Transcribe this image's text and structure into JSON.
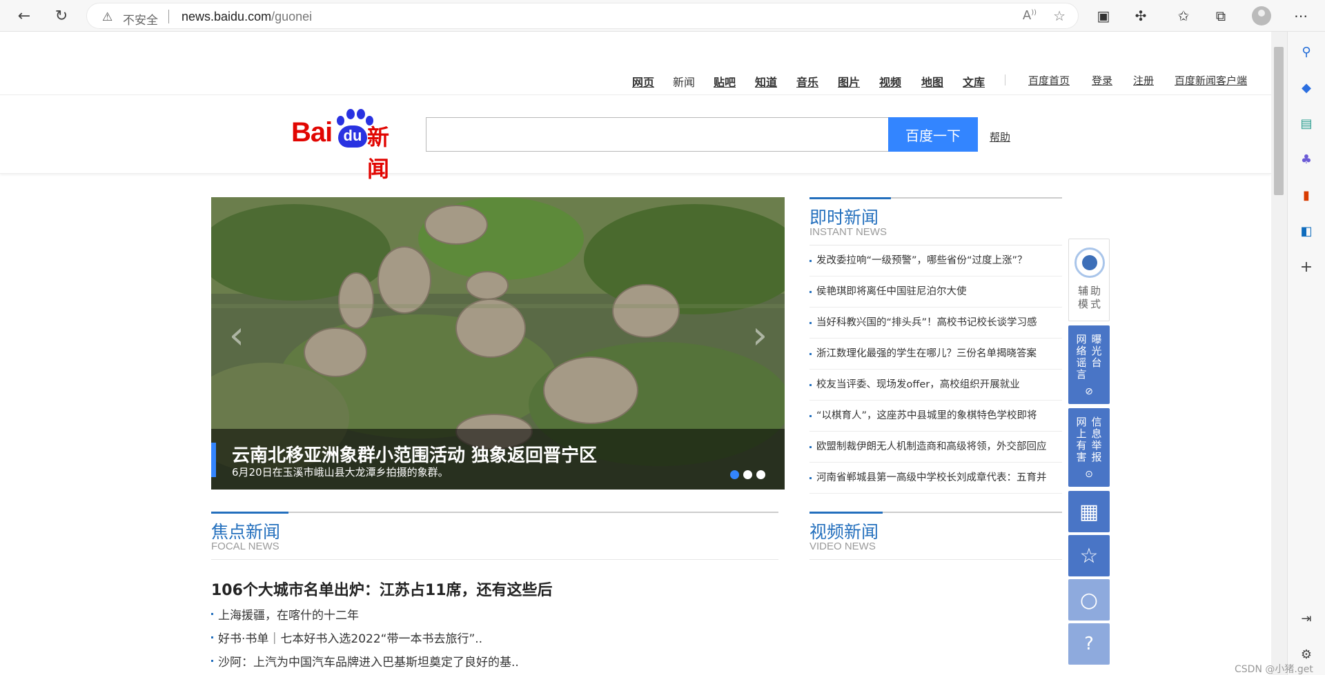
{
  "browser": {
    "security_label": "不安全",
    "url_host": "news.baidu.com",
    "url_path": "/guonei"
  },
  "top_nav": {
    "links": [
      "网页",
      "新闻",
      "贴吧",
      "知道",
      "音乐",
      "图片",
      "视频",
      "地图",
      "文库"
    ],
    "right_links": [
      "百度首页",
      "登录",
      "注册",
      "百度新闻客户端"
    ]
  },
  "search": {
    "logo_bai": "Bai",
    "logo_du": "du",
    "logo_news": "新闻",
    "placeholder": "",
    "button_label": "百度一下",
    "help_label": "帮助"
  },
  "carousel": {
    "title": "云南北移亚洲象群小范围活动 独象返回晋宁区",
    "subtitle": "6月20日在玉溪市峨山县大龙潭乡拍摄的象群。",
    "prev_label": "‹",
    "next_label": "›",
    "slide_count": 3,
    "active_index": 0
  },
  "instant_news": {
    "title": "即时新闻",
    "subtitle": "INSTANT NEWS",
    "items": [
      "发改委拉响“一级预警”，哪些省份“过度上涨”？",
      "侯艳琪即将离任中国驻尼泊尔大使",
      "当好科教兴国的“排头兵”！高校书记校长谈学习感",
      "浙江数理化最强的学生在哪儿？三份名单揭晓答案",
      "校友当评委、现场发offer，高校组织开展就业",
      "“以棋育人”，这座苏中县城里的象棋特色学校即将",
      "欧盟制裁伊朗无人机制造商和高级将领，外交部回应",
      "河南省郸城县第一高级中学校长刘成章代表：五育并"
    ]
  },
  "float_tools": {
    "assist_label": "辅助模式",
    "rumor_col1": "网络谣言",
    "rumor_col2": "曝光台",
    "report_col1": "网上有害",
    "report_col2": "信息举报"
  },
  "focal_news": {
    "title": "焦点新闻",
    "subtitle": "FOCAL NEWS",
    "headline": "106个大城市名单出炉：江苏占11席，还有这些后",
    "items": [
      "上海援疆，在喀什的十二年",
      "好书·书单｜七本好书入选2022“带一本书去旅行”..",
      "沙阿：上汽为中国汽车品牌进入巴基斯坦奠定了良好的基.."
    ]
  },
  "video_news": {
    "title": "视频新闻",
    "subtitle": "VIDEO NEWS"
  },
  "watermark": "CSDN @小猪.get",
  "colors": {
    "accent_blue": "#236fbd",
    "button_blue": "#3385ff",
    "logo_red": "#e10602",
    "logo_blue": "#2932e1",
    "tool_blue": "#4975c6"
  }
}
